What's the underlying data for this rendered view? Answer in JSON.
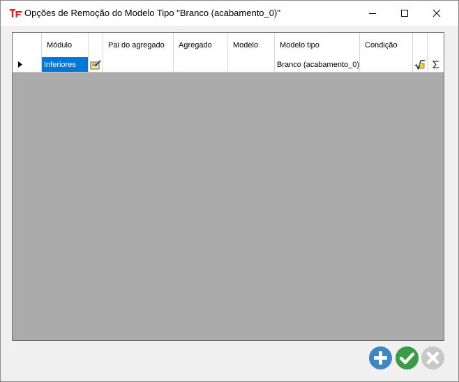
{
  "window": {
    "title": "Opções de Remoção do Modelo Tipo \"Branco (acabamento_0)\""
  },
  "grid": {
    "columns": [
      "Módulo",
      "",
      "Pai do agregado",
      "Agregado",
      "Modelo",
      "Modelo tipo",
      "Condição",
      "",
      ""
    ],
    "rows": [
      {
        "modulo": "Inferiores",
        "pai_do_agregado": "",
        "agregado": "",
        "modelo": "",
        "modelo_tipo": "Branco (acabamento_0)",
        "condicao": ""
      }
    ]
  },
  "icons": {
    "app": "app-icon",
    "minimize": "minimize-icon",
    "maximize": "maximize-icon",
    "close": "close-icon",
    "row_pointer": "row-pointer-icon",
    "edit": "edit-icon",
    "formula": "sqrt-formula-icon",
    "sum": "sigma-icon",
    "add": "plus-icon",
    "confirm": "checkmark-icon",
    "cancel": "x-icon"
  },
  "colors": {
    "selection": "#0078d7",
    "add": "#3d86c6",
    "confirm": "#3a9a45",
    "cancel": "#c8c8c8",
    "grid_bg": "#ababab"
  }
}
